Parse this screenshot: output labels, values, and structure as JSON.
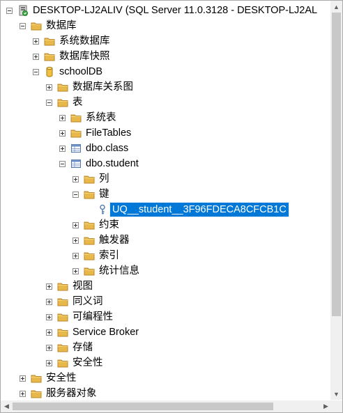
{
  "tree": {
    "server": "DESKTOP-LJ2ALIV (SQL Server 11.0.3128 - DESKTOP-LJ2AL",
    "databases": "数据库",
    "system_databases": "系统数据库",
    "db_snapshots": "数据库快照",
    "schooldb": "schoolDB",
    "db_diagrams": "数据库关系图",
    "tables": "表",
    "system_tables": "系统表",
    "filetables": "FileTables",
    "dbo_class": "dbo.class",
    "dbo_student": "dbo.student",
    "columns": "列",
    "keys": "键",
    "uq_key": "UQ__student__3F96FDECA8CFCB1C",
    "constraints": "约束",
    "triggers": "触发器",
    "indexes": "索引",
    "statistics": "统计信息",
    "views": "视图",
    "synonyms": "同义词",
    "programmability": "可编程性",
    "service_broker": "Service Broker",
    "storage": "存储",
    "db_security": "安全性",
    "security": "安全性",
    "server_objects": "服务器对象"
  },
  "colors": {
    "selection": "#0078d7",
    "folder": "#e8b84a",
    "db": "#f0c040"
  }
}
